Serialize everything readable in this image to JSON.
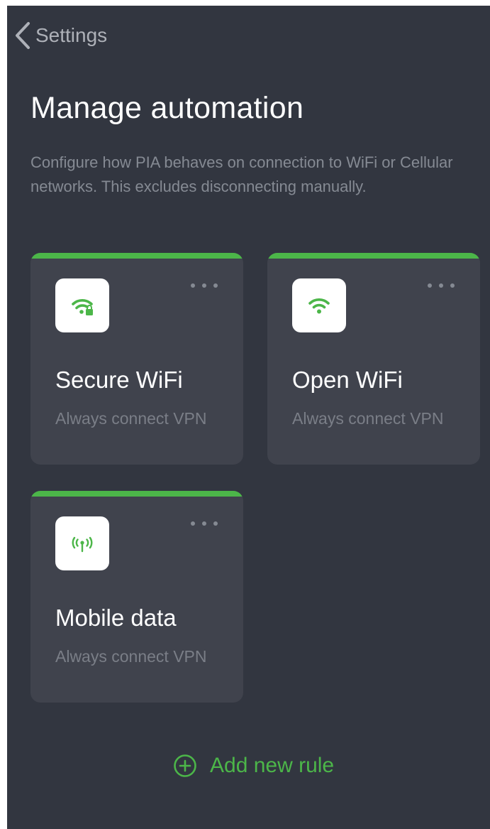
{
  "header": {
    "back_label": "Settings"
  },
  "title": "Manage automation",
  "description": "Configure how PIA behaves on connection to WiFi or Cellular networks. This excludes disconnecting manually.",
  "colors": {
    "background": "#323640",
    "card": "#40434d",
    "accent": "#4cb649",
    "muted_text": "#858a93"
  },
  "cards": [
    {
      "icon": "secure-wifi-icon",
      "title": "Secure WiFi",
      "subtitle": "Always connect VPN"
    },
    {
      "icon": "open-wifi-icon",
      "title": "Open WiFi",
      "subtitle": "Always connect VPN"
    },
    {
      "icon": "mobile-data-icon",
      "title": "Mobile data",
      "subtitle": "Always connect VPN"
    }
  ],
  "add_rule": {
    "icon": "plus-circle-icon",
    "label": "Add new rule"
  }
}
